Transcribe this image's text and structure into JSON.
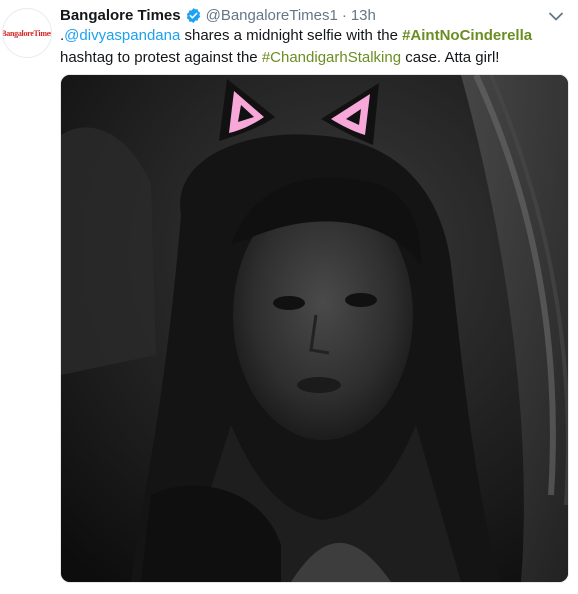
{
  "tweet": {
    "avatar_text": "BangaloreTimes",
    "display_name": "Bangalore Times",
    "handle": "@BangaloreTimes1",
    "separator": "·",
    "time": "13h",
    "body": {
      "prefix": ".",
      "mention": "@divyaspandana",
      "text_1": " shares a midnight selfie with the ",
      "hashtag_1": "#AintNoCinderella",
      "text_2": " hashtag to protest against the ",
      "hashtag_2": "#ChandigarhStalking",
      "text_3": " case. Atta girl!"
    }
  },
  "icons": {
    "verified": "verified-badge-icon",
    "caret": "chevron-down-icon"
  },
  "colors": {
    "link": "#1da1f2",
    "hashtag": "#6b8e23",
    "verified": "#1da1f2",
    "secondary_text": "#657786",
    "brand_red": "#d32626",
    "ear_pink": "#f7a8d8"
  }
}
